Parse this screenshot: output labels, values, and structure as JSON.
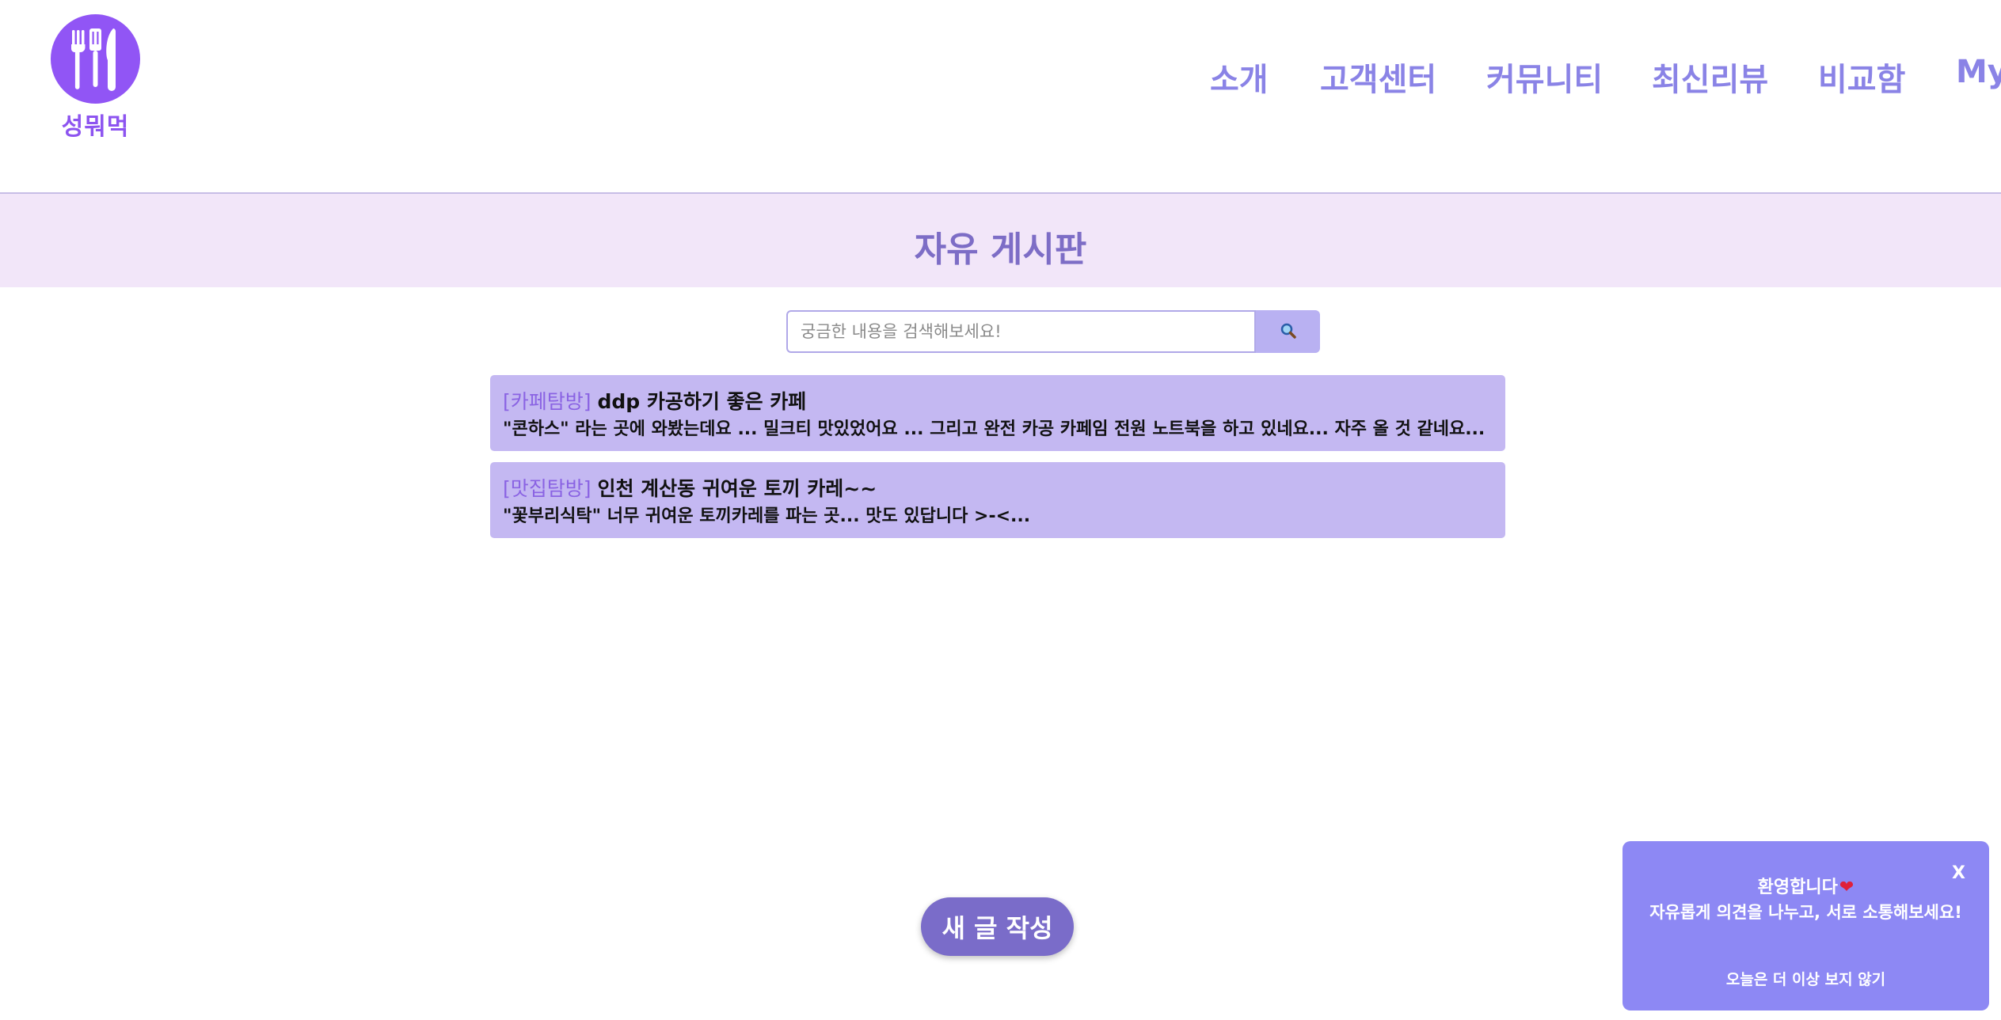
{
  "brand": {
    "name": "성뭐먹",
    "logo_icon": "cutlery-icon",
    "logo_color": "#9155f5"
  },
  "nav": {
    "items": [
      "소개",
      "고객센터",
      "커뮤니티",
      "최신리뷰",
      "비교함",
      "My"
    ]
  },
  "board": {
    "title": "자유 게시판"
  },
  "search": {
    "placeholder": "궁금한 내용을 검색해보세요!",
    "value": "",
    "button_icon": "search-icon"
  },
  "posts": [
    {
      "category": "[카페탐방]",
      "title": "ddp 카공하기 좋은 카페",
      "excerpt": "\"콘하스\" 라는 곳에 와봤는데요 ... 밀크티 맛있었어요 ... 그리고 완전 카공 카페임 전원 노트북을 하고 있네요... 자주 올 것 같네요... ..."
    },
    {
      "category": "[맛집탐방]",
      "title": "인천 계산동 귀여운 토끼 카레~~",
      "excerpt": "\"꽃부리식탁\" 너무 귀여운 토끼카레를 파는 곳... 맛도 있답니다 >-<..."
    }
  ],
  "write_button": {
    "label": "새 글 작성"
  },
  "popup": {
    "greeting": "환영합니다",
    "heart_icon": "heart-icon",
    "message": "자유롭게 의견을 나누고, 서로 소통해보세요!",
    "close_label": "X",
    "dismiss_label": "오늘은 더 이상 보지 않기"
  },
  "colors": {
    "accent": "#8a83e6",
    "banner_bg": "#f2e6f9",
    "post_bg": "#c4b8f2",
    "button": "#7a6cc9",
    "popup_bg": "#8d88f4"
  }
}
